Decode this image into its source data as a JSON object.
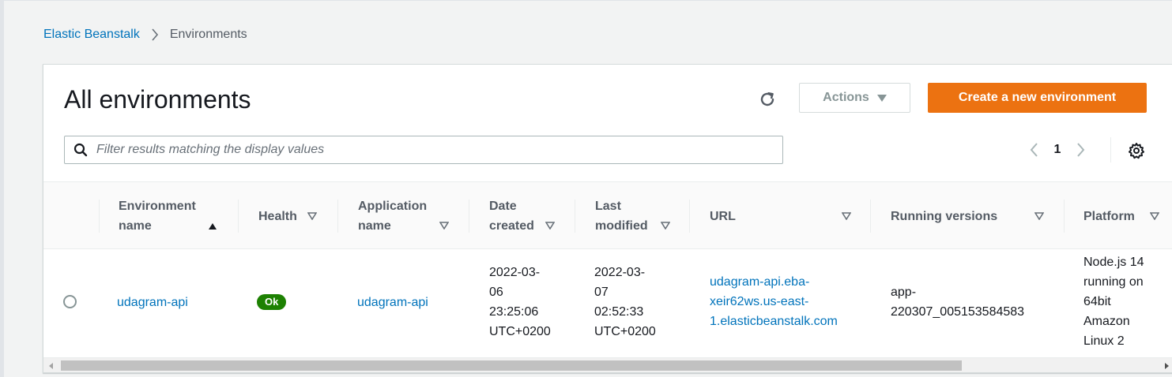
{
  "breadcrumb": {
    "root": "Elastic Beanstalk",
    "current": "Environments"
  },
  "panel": {
    "title": "All environments",
    "actions_label": "Actions",
    "create_label": "Create a new environment"
  },
  "filter": {
    "placeholder": "Filter results matching the display values"
  },
  "pagination": {
    "current_page": "1"
  },
  "table": {
    "columns": [
      {
        "line1": "Environment",
        "line2": "name"
      },
      {
        "line1": "Health",
        "line2": ""
      },
      {
        "line1": "Application",
        "line2": "name"
      },
      {
        "line1": "Date",
        "line2": "created"
      },
      {
        "line1": "Last",
        "line2": "modified"
      },
      {
        "line1": "URL",
        "line2": ""
      },
      {
        "line1": "Running versions",
        "line2": ""
      },
      {
        "line1": "Platform",
        "line2": ""
      }
    ],
    "rows": [
      {
        "environment_name": "udagram-api",
        "health": "Ok",
        "application_name": "udagram-api",
        "date_created": [
          "2022-03-",
          "06",
          "23:25:06",
          "UTC+0200"
        ],
        "last_modified": [
          "2022-03-",
          "07",
          "02:52:33",
          "UTC+0200"
        ],
        "url": [
          "udagram-api.eba-",
          "xeir62ws.us-east-",
          "1.elasticbeanstalk.com"
        ],
        "running_versions": [
          "app-",
          "220307_005153584583"
        ],
        "platform": [
          "Node.js 14",
          "running on",
          "64bit",
          "Amazon",
          "Linux 2"
        ]
      }
    ]
  },
  "colors": {
    "primary_button": "#ec7211",
    "link": "#0073bb",
    "health_ok": "#1d8102"
  }
}
